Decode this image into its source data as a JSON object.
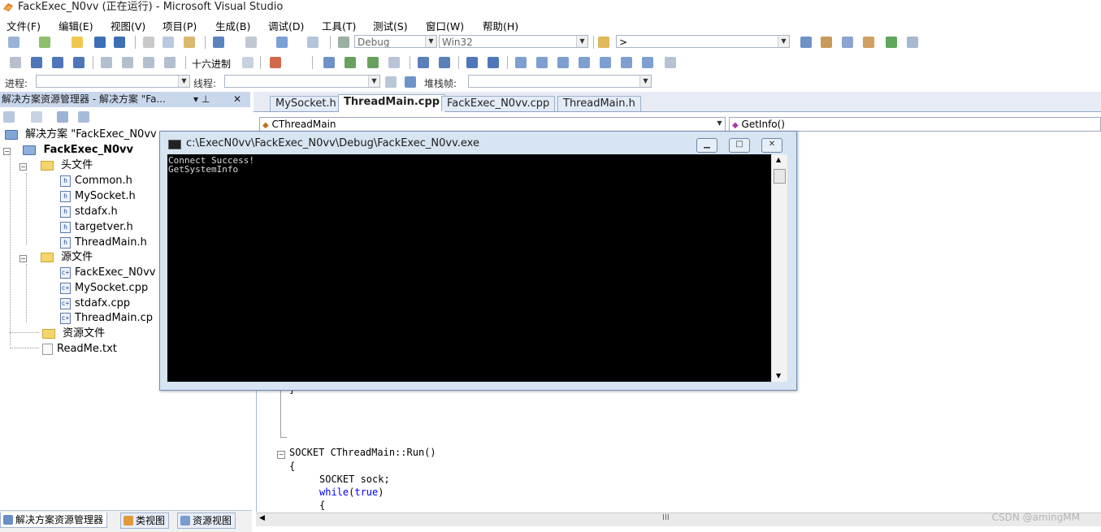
{
  "window": {
    "title": "FackExec_N0vv (正在运行) - Microsoft Visual Studio"
  },
  "menu": [
    "文件(F)",
    "编辑(E)",
    "视图(V)",
    "项目(P)",
    "生成(B)",
    "调试(D)",
    "工具(T)",
    "测试(S)",
    "窗口(W)",
    "帮助(H)"
  ],
  "toolbar1": {
    "config": "Debug",
    "platform": "Win32",
    "find_value": ">"
  },
  "toolbar2": {
    "hex_label": "十六进制"
  },
  "toolbar3": {
    "process_label": "进程:",
    "thread_label": "线程:",
    "stackframe_label": "堆栈帧:"
  },
  "solution_explorer": {
    "title": "解决方案资源管理器 - 解决方案 \"Fa...",
    "pin_glyph": "▾ ⊥",
    "close_glyph": "✕",
    "solution": "解决方案 \"FackExec_N0vv",
    "project": "FackExec_N0vv",
    "header_folder": "头文件",
    "headers": [
      "Common.h",
      "MySocket.h",
      "stdafx.h",
      "targetver.h",
      "ThreadMain.h"
    ],
    "source_folder": "源文件",
    "sources": [
      "FackExec_N0vv",
      "MySocket.cpp",
      "stdafx.cpp",
      "ThreadMain.cp"
    ],
    "resource_folder": "资源文件",
    "readme": "ReadMe.txt"
  },
  "bottom_tabs": [
    "解决方案资源管理器",
    "类视图",
    "资源视图"
  ],
  "doc_tabs": [
    "MySocket.h",
    "ThreadMain.cpp",
    "FackExec_N0vv.cpp",
    "ThreadMain.h"
  ],
  "nav": {
    "class": "CThreadMain",
    "method": "GetInfo()"
  },
  "code": {
    "brace_close": "}",
    "func_sig": "SOCKET CThreadMain::Run()",
    "brace_open": "{",
    "line_sock": "SOCKET sock;",
    "kw_while": "while",
    "kw_true": "true",
    "brace_open2": "{"
  },
  "console": {
    "title": "c:\\ExecN0vv\\FackExec_N0vv\\Debug\\FackExec_N0vv.exe",
    "lines": [
      "Connect Success!",
      "GetSystemInfo"
    ]
  },
  "hscroll_label": "III",
  "watermark": "CSDN @amingMM"
}
